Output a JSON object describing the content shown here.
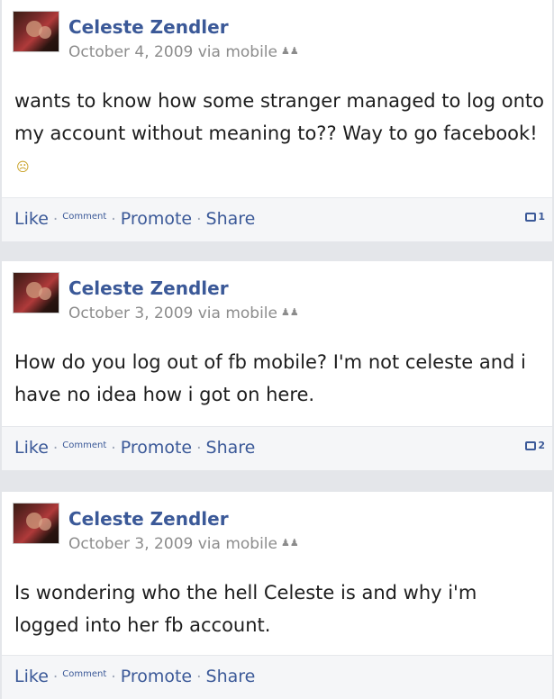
{
  "posts": [
    {
      "author": "Celeste Zendler",
      "date": "October 4, 2009 via mobile",
      "audience_icon": "people-icon",
      "text": "wants to know how some stranger managed to log onto my account without meaning to?? Way to go facebook!",
      "emoticon": "☹",
      "actions": {
        "like": "Like",
        "comment": "Comment",
        "promote": "Promote",
        "share": "Share"
      },
      "comment_count": "1"
    },
    {
      "author": "Celeste Zendler",
      "date": "October 3, 2009 via mobile",
      "audience_icon": "people-icon",
      "text": "How do you log out of fb mobile? I'm not celeste and i have no idea how i got on here.",
      "actions": {
        "like": "Like",
        "comment": "Comment",
        "promote": "Promote",
        "share": "Share"
      },
      "comment_count": "2"
    },
    {
      "author": "Celeste Zendler",
      "date": "October 3, 2009 via mobile",
      "audience_icon": "people-icon",
      "text": "Is wondering who the hell Celeste is and why i'm logged into her fb account.",
      "actions": {
        "like": "Like",
        "comment": "Comment",
        "promote": "Promote",
        "share": "Share"
      }
    }
  ]
}
